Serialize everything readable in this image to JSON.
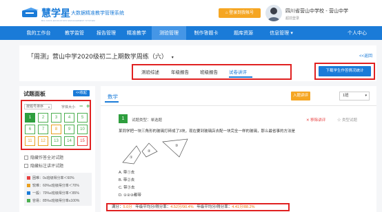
{
  "header": {
    "logo_text": "慧学星",
    "logo_subtitle": "大数据精准教学管理系统",
    "logo_tagline": "BIG DATA EDUCATION MANAGEMENT SYSTEM",
    "return_button": "登录到我帐号",
    "school_name": "四川省营山中学校 - 营山中学",
    "school_sub": "超前登录"
  },
  "nav": {
    "items": [
      "我的工作台",
      "教学监管",
      "报告管理",
      "精准教学",
      "测验管理",
      "制作答题卡",
      "题库资源",
      "信息管理 ▾",
      "个人中心"
    ],
    "active_index": 4
  },
  "report": {
    "title": "「周测」营山中学2020级初二上期数学周练（六）",
    "back_label": "<<返回",
    "tabs": [
      "测验综述",
      "年级报告",
      "班级报告",
      "试卷讲评"
    ],
    "active_tab": 3,
    "download_label": "下载学生作答情况统计"
  },
  "panel": {
    "title": "试题面板",
    "collapse_label": "<<收起",
    "sort_label": "按题号排序",
    "font_size_label": "字体大小",
    "font_minus": "−",
    "font_plus": "+",
    "questions": [
      {
        "n": "1",
        "state": "selected"
      },
      {
        "n": "2",
        "state": "normal"
      },
      {
        "n": "3",
        "state": "normal"
      },
      {
        "n": "4",
        "state": "normal"
      },
      {
        "n": "5",
        "state": "normal"
      },
      {
        "n": "6",
        "state": "normal"
      },
      {
        "n": "7",
        "state": "normal"
      },
      {
        "n": "8",
        "state": "warn"
      },
      {
        "n": "9",
        "state": "normal"
      },
      {
        "n": "10",
        "state": "normal"
      },
      {
        "n": "11",
        "state": "warn"
      },
      {
        "n": "12",
        "state": "warn"
      },
      {
        "n": "13",
        "state": "normal"
      },
      {
        "n": "14",
        "state": "normal"
      },
      {
        "n": "15",
        "state": "bad"
      }
    ],
    "checkbox_hide_correct": "隐藏作答全对试题",
    "checkbox_hide_explained": "隐藏标注讲评试题",
    "legend": [
      {
        "label": "困难：0≤班级得分率＜60%",
        "color": "#e84040"
      },
      {
        "label": "较难：60%≤班级得分率＜70%",
        "color": "#e8a020"
      },
      {
        "label": "一般：70%≤班级得分率＜85%",
        "color": "#1a7bd8"
      },
      {
        "label": "容易：85%≤班级得分率≤100%",
        "color": "#4caf50"
      }
    ]
  },
  "main": {
    "subject": "数学",
    "classic_label": "入题讲评",
    "class_select": "1班",
    "question_number": "1",
    "question_type": "试题类型：单选题",
    "remove_label": "✕ 移除讲评",
    "similar_label": "☆ 类型试题",
    "question_text": "某同学把一块三角形的玻璃打碎成了3块，现在要到玻璃店去配一块完全一样的玻璃，那么最省事的方法是",
    "figure_labels": [
      "①",
      "②",
      "③"
    ],
    "options": [
      "A. 带①去",
      "B. 带②去",
      "C. 带③去",
      "D. ①②③都带"
    ],
    "score_full": "满分：",
    "score_full_value": "5.0分",
    "score_grade": "年级平均分/得分率：",
    "score_grade_value": "4.52分/90.4%",
    "score_class": "年级平均分/得分率：",
    "score_class_value": "4.41分/88.2%"
  },
  "colors": {
    "brand": "#1a7bd8",
    "accent_orange": "#f5a623",
    "green": "#4caf50",
    "highlight_red": "#e02020"
  }
}
